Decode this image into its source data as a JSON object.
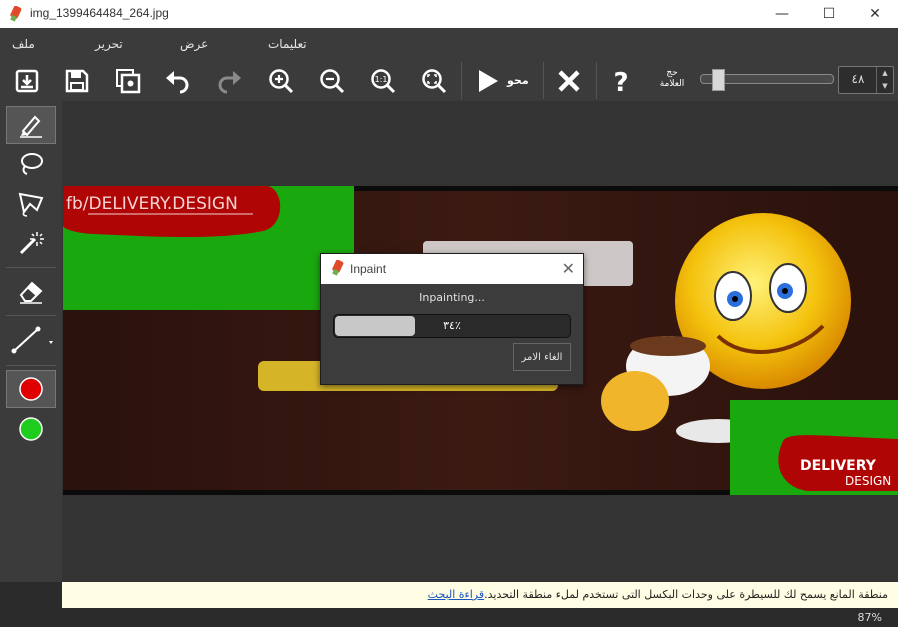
{
  "window": {
    "title": "img_1399464484_264.jpg",
    "minimize_glyph": "—",
    "maximize_glyph": "☐",
    "close_glyph": "✕"
  },
  "menu": {
    "items": [
      "ملف",
      "تحرير",
      "عرض",
      "تعليمات"
    ]
  },
  "toolbar": {
    "icons": [
      "open-icon",
      "save-icon",
      "preview-icon",
      "undo-icon",
      "redo-icon",
      "zoom-in-icon",
      "zoom-out-icon",
      "zoom-actual-icon",
      "zoom-fit-icon"
    ],
    "zoom_actual_label": "1:1",
    "erase_label": "محو",
    "brush_size_label_line1": "حج",
    "brush_size_label_line2": "العلامة",
    "brush_size_value": "٤٨",
    "brush_size_level": 0.1
  },
  "left_tools": [
    "marker-icon",
    "lasso-icon",
    "polygon-lasso-icon",
    "magic-wand-icon",
    "eraser-icon",
    "line-icon",
    "red-color-icon",
    "green-color-icon"
  ],
  "colors": {
    "red_swatch": "#e00000",
    "green_swatch": "#1ecc1e",
    "mask_green": "#1aa80f",
    "mask_red": "#b00505",
    "text_yellow": "#e7c52a"
  },
  "image_text": {
    "watermark": "fb/DELIVERY.DESIGN",
    "logo_line1": "DELIVERY",
    "logo_line2": "DESIGN"
  },
  "dialog": {
    "title": "Inpaint",
    "message": "Inpainting...",
    "progress_text": "٣٤٪",
    "progress_fraction": 0.34,
    "cancel_label": "الغاء الامر"
  },
  "status": {
    "text": "منطقة المانع يسمح لك للسيطرة على وحدات البكسل التى تستخدم لملء منطقة التحديد.",
    "link": "قراءة البحث",
    "zoom": "87%"
  }
}
